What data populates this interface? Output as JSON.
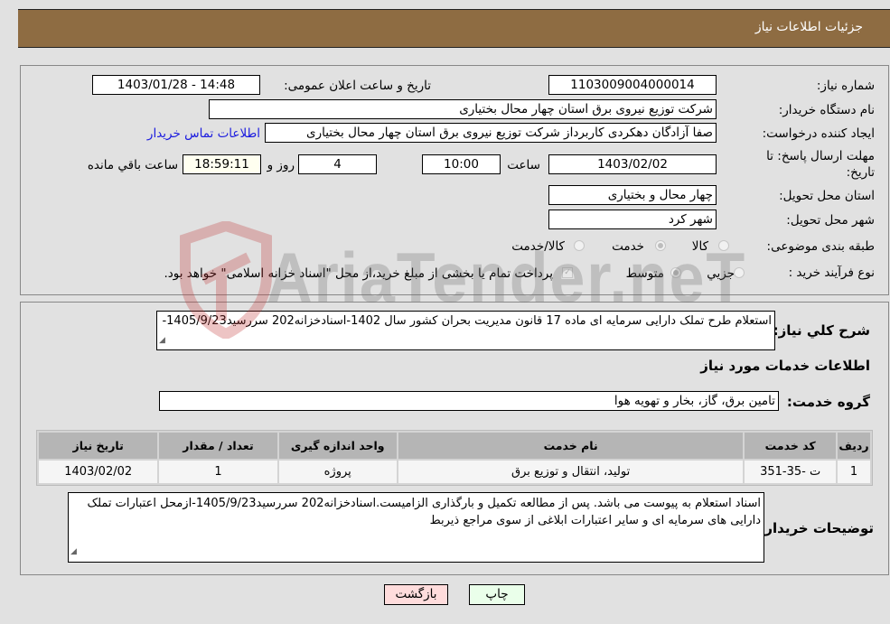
{
  "header": {
    "title": "جزئیات اطلاعات نیاز"
  },
  "fields": {
    "need_number": {
      "label": "شماره نیاز:",
      "value": "1103009004000014"
    },
    "announce_datetime": {
      "label": "تاریخ و ساعت اعلان عمومی:",
      "value": "1403/01/28 - 14:48"
    },
    "buyer_org": {
      "label": "نام دستگاه خریدار:",
      "value": "شرکت توزیع نیروی برق استان چهار محال بختیاری"
    },
    "requester": {
      "label": "ایجاد کننده درخواست:",
      "value": "صفا آزادگان دهکردی کاربرداز شرکت توزیع نیروی برق استان چهار محال بختیاری"
    },
    "buyer_contact_link": "اطلاعات تماس خریدار",
    "deadline": {
      "label_line1": "مهلت ارسال پاسخ: تا",
      "label_line2": "تاریخ:",
      "date": "1403/02/02",
      "time_label": "ساعت",
      "time": "10:00",
      "days": "4",
      "days_label": "روز و",
      "remaining": "18:59:11",
      "remaining_label": "ساعت باقي مانده"
    },
    "delivery_province": {
      "label": "استان محل تحویل:",
      "value": "چهار محال و بختیاری"
    },
    "delivery_city": {
      "label": "شهر محل تحویل:",
      "value": "شهر کرد"
    },
    "category": {
      "label": "طبقه بندی موضوعی:",
      "options": [
        "کالا",
        "خدمت",
        "کالا/خدمت"
      ],
      "selected": "خدمت"
    },
    "purchase_type": {
      "label": "نوع فرآیند خرید :",
      "options": [
        "جزيي",
        "متوسط"
      ],
      "selected": "متوسط",
      "treasury_checkbox_label": "پرداخت تمام یا بخشی از مبلغ خرید،از محل \"اسناد خزانه اسلامی\" خواهد بود.",
      "treasury_checked": true
    }
  },
  "description": {
    "label": "شرح کلي نیاز:",
    "value": "استعلام طرح تملک دارایی سرمایه ای ماده 17 قانون مدیریت بحران کشور سال 1402-اسنادخزانه202 سررسید1405/9/23-"
  },
  "services": {
    "section_title": "اطلاعات خدمات مورد نیاز",
    "group_label": "گروه خدمت:",
    "group_value": "تامین برق، گاز، بخار و تهویه هوا",
    "table": {
      "headers": [
        "ردیف",
        "کد خدمت",
        "نام خدمت",
        "واحد اندازه گیری",
        "تعداد / مقدار",
        "تاریخ نیاز"
      ],
      "rows": [
        [
          "1",
          "ت -35-351",
          "تولید، انتقال و توزیع برق",
          "پروژه",
          "1",
          "1403/02/02"
        ]
      ]
    }
  },
  "buyer_notes": {
    "label": "توضیحات خریدار:",
    "value": "اسناد استعلام به پیوست می باشد. پس از مطالعه تکمیل و بارگذاری الزامیست.اسنادخزانه202 سررسید1405/9/23-ازمحل اعتبارات تملک دارایی های سرمایه ای و سایر اعتبارات ابلاغی از سوی مراجع ذیربط"
  },
  "buttons": {
    "print": "چاپ",
    "back": "بازگشت"
  },
  "watermark": {
    "text": "AriaTender.neT"
  },
  "colors": {
    "header_bg": "#8e6c42",
    "print_bg": "#eaffea",
    "back_bg": "#ffdcdc",
    "link": "#1a1adf"
  }
}
